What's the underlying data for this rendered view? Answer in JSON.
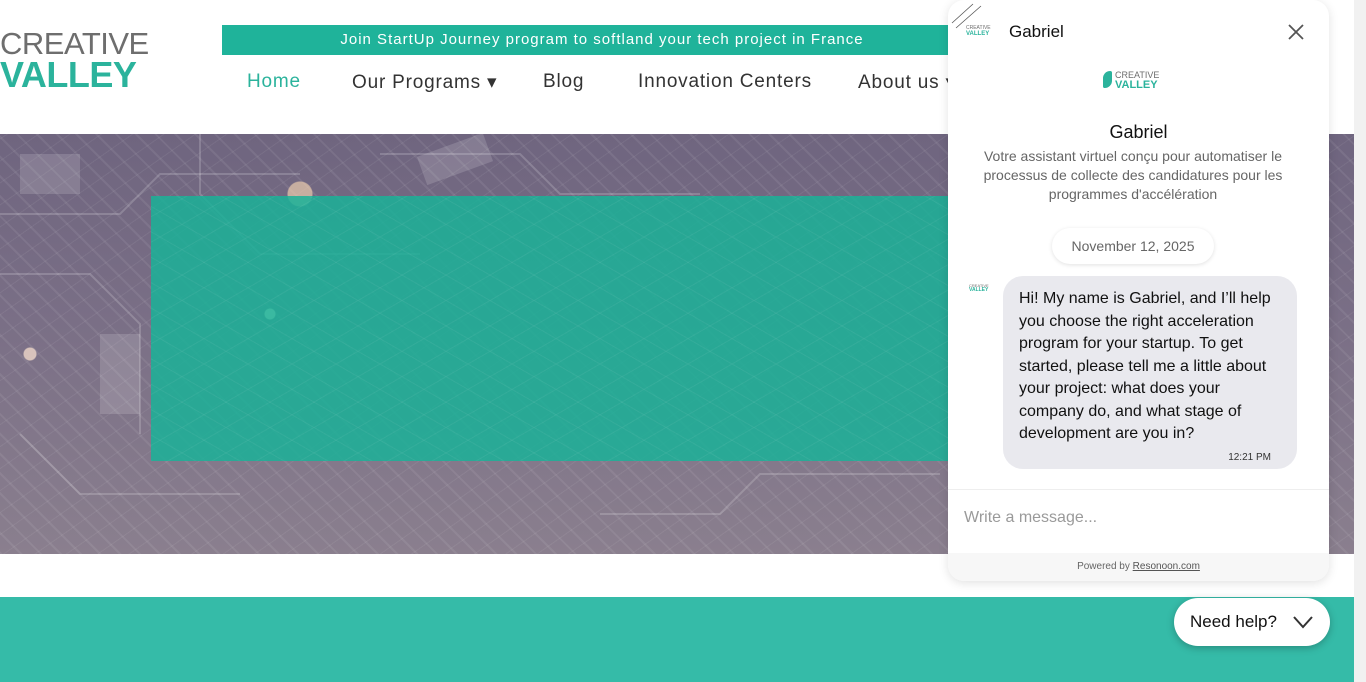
{
  "header": {
    "logo_line1": "CREATIVE",
    "logo_line2": "VALLEY",
    "promo": "Join StartUp Journey program to softland your tech project in France"
  },
  "nav": {
    "items": [
      {
        "label": "Home"
      },
      {
        "label": "Our Programs ▾"
      },
      {
        "label": "Blog"
      },
      {
        "label": "Innovation Centers"
      },
      {
        "label": "About us ▾"
      }
    ]
  },
  "chat": {
    "header_name": "Gabriel",
    "logo_line1": "CREATIVE",
    "logo_line2": "VALLEY",
    "bot_title": "Gabriel",
    "bot_description": "Votre assistant virtuel conçu pour automatiser le processus de collecte des candidatures pour les programmes d'accélération",
    "date": "November 12, 2025",
    "message_text": "Hi! My name is Gabriel, and I’ll help you choose the right acceleration program for your startup. To get started, please tell me a little about your project: what does your company do, and what stage of development are you in?",
    "message_time": "12:21 PM",
    "input_placeholder": "Write a message...",
    "powered_prefix": "Powered by",
    "powered_link": "Resonoon.com"
  },
  "help_button": {
    "label": "Need help?"
  },
  "colors": {
    "brand_teal": "#2bb39c",
    "promo_bar": "#1fb39a",
    "teal_band": "#35bba8",
    "bubble": "#e9e9ee"
  },
  "icons": {
    "close": "close-icon",
    "help_toggle": "chevron-down-icon"
  }
}
